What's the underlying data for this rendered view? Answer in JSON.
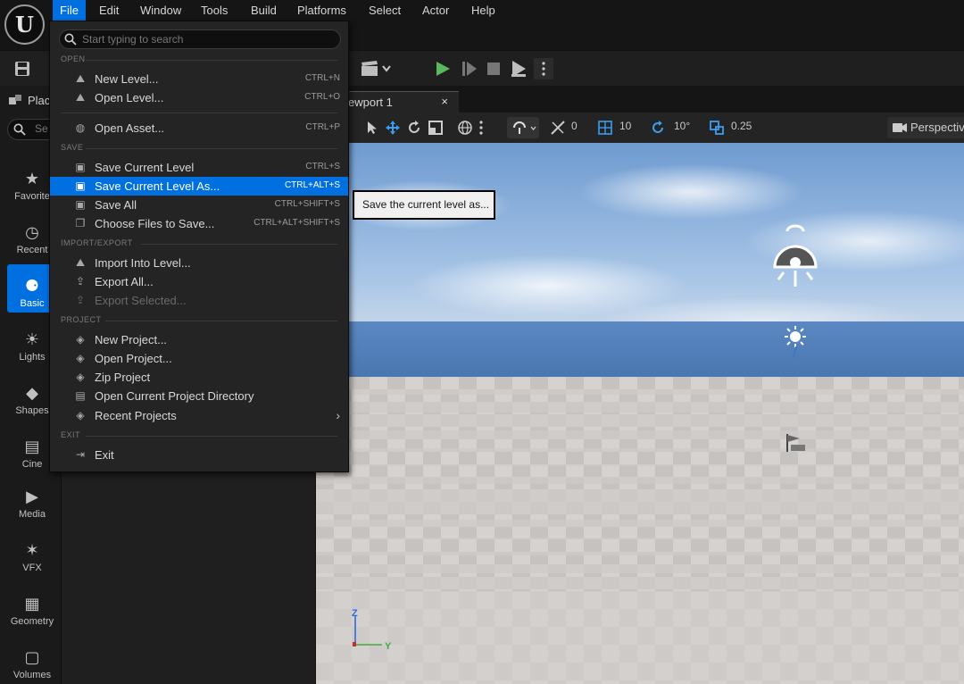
{
  "menubar": {
    "logo": "U",
    "items": [
      "File",
      "Edit",
      "Window",
      "Tools",
      "Build",
      "Platforms",
      "Select",
      "Actor",
      "Help"
    ],
    "active": "File"
  },
  "toolbar": {
    "save_icon": "save-icon",
    "play_color": "#5cb85c"
  },
  "left_panel": {
    "tab_label": "Plac",
    "search_placeholder": "Se",
    "modes": [
      {
        "label": "Favorite",
        "icon": "★"
      },
      {
        "label": "Recent",
        "icon": "◷"
      },
      {
        "label": "Basic",
        "icon": "⚈"
      },
      {
        "label": "Lights",
        "icon": "☀"
      },
      {
        "label": "Shapes",
        "icon": "◆"
      },
      {
        "label": "Cine",
        "icon": "▤"
      },
      {
        "label": "Media",
        "icon": "▶"
      },
      {
        "label": "VFX",
        "icon": "✶"
      },
      {
        "label": "Geometry",
        "icon": "▦"
      },
      {
        "label": "Volumes",
        "icon": "▢"
      }
    ],
    "active_mode": "Basic"
  },
  "viewport": {
    "tab_label": "ewport 1",
    "close_glyph": "×",
    "translate_snap": "0",
    "grid_snap": "10",
    "rotate_snap": "10°",
    "scale_snap": "0.25",
    "view_mode": "Perspectiv",
    "axis_z": "Z",
    "axis_y": "Y"
  },
  "tooltip": "Save the current level as...",
  "file_menu": {
    "search_placeholder": "Start typing to search",
    "sections": {
      "open": "OPEN",
      "save": "SAVE",
      "import_export": "IMPORT/EXPORT",
      "project": "PROJECT",
      "exit": "EXIT"
    },
    "items": {
      "new_level": {
        "label": "New Level...",
        "shortcut": "CTRL+N"
      },
      "open_level": {
        "label": "Open Level...",
        "shortcut": "CTRL+O"
      },
      "open_asset": {
        "label": "Open Asset...",
        "shortcut": "CTRL+P"
      },
      "save_current_level": {
        "label": "Save Current Level",
        "shortcut": "CTRL+S"
      },
      "save_current_level_as": {
        "label": "Save Current Level As...",
        "shortcut": "CTRL+ALT+S"
      },
      "save_all": {
        "label": "Save All",
        "shortcut": "CTRL+SHIFT+S"
      },
      "choose_files": {
        "label": "Choose Files to Save...",
        "shortcut": "CTRL+ALT+SHIFT+S"
      },
      "import_into_level": {
        "label": "Import Into Level..."
      },
      "export_all": {
        "label": "Export All..."
      },
      "export_selected": {
        "label": "Export Selected..."
      },
      "new_project": {
        "label": "New Project..."
      },
      "open_project": {
        "label": "Open Project..."
      },
      "zip_project": {
        "label": "Zip Project"
      },
      "open_project_dir": {
        "label": "Open Current Project Directory"
      },
      "recent_projects": {
        "label": "Recent Projects"
      },
      "exit": {
        "label": "Exit"
      }
    },
    "highlight_color": "#0070e0"
  }
}
